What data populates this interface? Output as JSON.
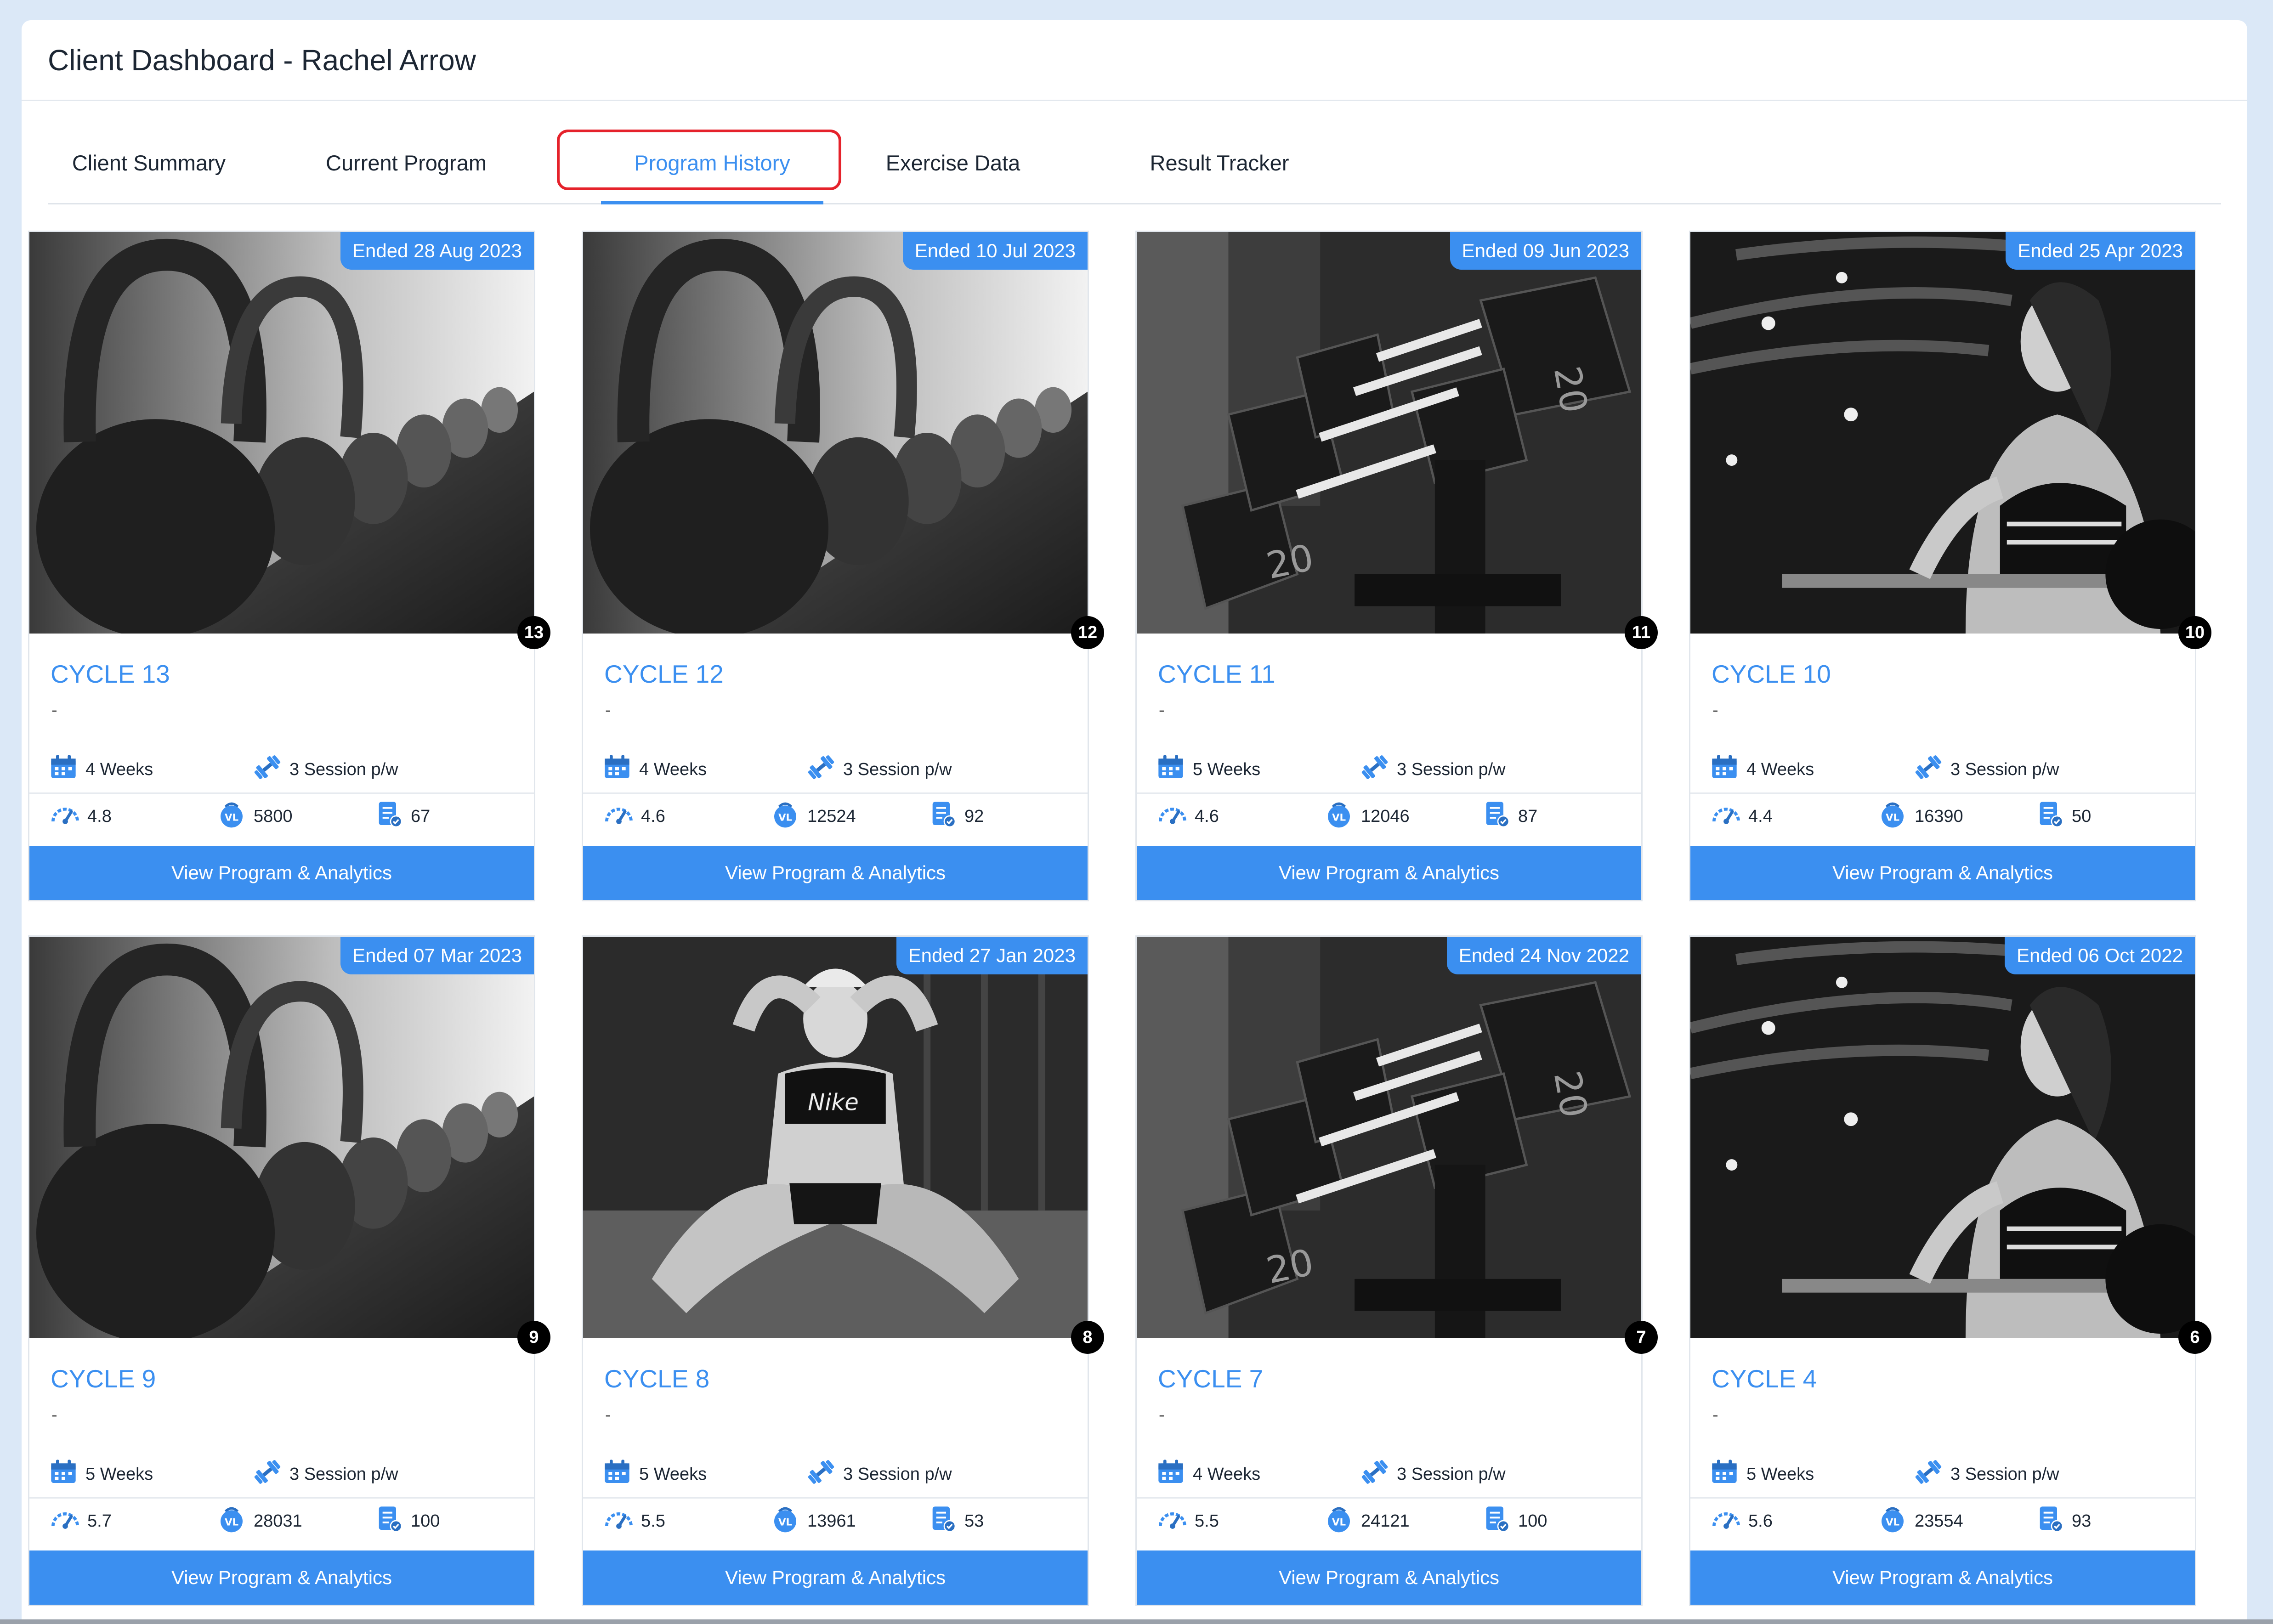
{
  "header": {
    "title": "Client Dashboard - Rachel Arrow"
  },
  "tabs": [
    {
      "label": "Client Summary",
      "active": false
    },
    {
      "label": "Current Program",
      "active": false
    },
    {
      "label": "Program History",
      "active": true
    },
    {
      "label": "Exercise Data",
      "active": false
    },
    {
      "label": "Result Tracker",
      "active": false
    }
  ],
  "colors": {
    "accent": "#3b8ff0",
    "highlight": "#e5222b",
    "badge": "#000000"
  },
  "button_label": "View Program & Analytics",
  "programs": [
    {
      "ended": "Ended 28 Aug 2023",
      "number": "13",
      "title": "CYCLE 13",
      "subtitle": "-",
      "weeks": "4 Weeks",
      "sessions": "3 Session p/w",
      "intensity": "4.8",
      "volume": "5800",
      "completion": "67",
      "image": "kettlebells"
    },
    {
      "ended": "Ended 10 Jul 2023",
      "number": "12",
      "title": "CYCLE 12",
      "subtitle": "-",
      "weeks": "4 Weeks",
      "sessions": "3 Session p/w",
      "intensity": "4.6",
      "volume": "12524",
      "completion": "92",
      "image": "kettlebells"
    },
    {
      "ended": "Ended 09 Jun 2023",
      "number": "11",
      "title": "CYCLE 11",
      "subtitle": "-",
      "weeks": "5 Weeks",
      "sessions": "3 Session p/w",
      "intensity": "4.6",
      "volume": "12046",
      "completion": "87",
      "image": "dumbbell-rack"
    },
    {
      "ended": "Ended 25 Apr 2023",
      "number": "10",
      "title": "CYCLE 10",
      "subtitle": "-",
      "weeks": "4 Weeks",
      "sessions": "3 Session p/w",
      "intensity": "4.4",
      "volume": "16390",
      "completion": "50",
      "image": "woman-curl"
    },
    {
      "ended": "Ended 07 Mar 2023",
      "number": "9",
      "title": "CYCLE 9",
      "subtitle": "-",
      "weeks": "5 Weeks",
      "sessions": "3 Session p/w",
      "intensity": "5.7",
      "volume": "28031",
      "completion": "100",
      "image": "kettlebells"
    },
    {
      "ended": "Ended 27 Jan 2023",
      "number": "8",
      "title": "CYCLE 8",
      "subtitle": "-",
      "weeks": "5 Weeks",
      "sessions": "3 Session p/w",
      "intensity": "5.5",
      "volume": "13961",
      "completion": "53",
      "image": "woman-situp"
    },
    {
      "ended": "Ended 24 Nov 2022",
      "number": "7",
      "title": "CYCLE 7",
      "subtitle": "-",
      "weeks": "4 Weeks",
      "sessions": "3 Session p/w",
      "intensity": "5.5",
      "volume": "24121",
      "completion": "100",
      "image": "dumbbell-rack"
    },
    {
      "ended": "Ended 06 Oct 2022",
      "number": "6",
      "title": "CYCLE 4",
      "subtitle": "-",
      "weeks": "5 Weeks",
      "sessions": "3 Session p/w",
      "intensity": "5.6",
      "volume": "23554",
      "completion": "93",
      "image": "woman-curl"
    }
  ],
  "icons": {
    "weeks": "calendar-icon",
    "sessions": "dumbbell-icon",
    "intensity": "speedometer-icon",
    "volume": "volume-load-icon",
    "completion": "checklist-icon"
  },
  "volume_icon_text": "VL"
}
